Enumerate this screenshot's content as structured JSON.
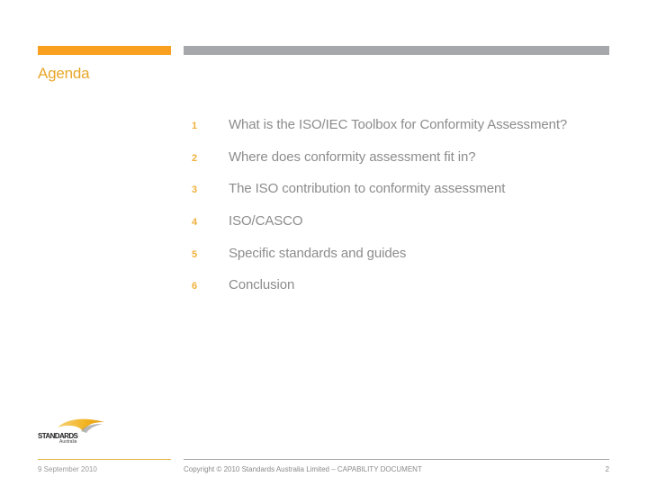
{
  "header": {
    "title": "Agenda",
    "accent_color": "#f9a020",
    "bar_color": "#a6a7ab"
  },
  "agenda": {
    "items": [
      {
        "number": "1",
        "label": "What is the ISO/IEC Toolbox for Conformity Assessment?"
      },
      {
        "number": "2",
        "label": "Where does conformity assessment fit in?"
      },
      {
        "number": "3",
        "label": "The ISO contribution to conformity assessment"
      },
      {
        "number": "4",
        "label": "ISO/CASCO"
      },
      {
        "number": "5",
        "label": "Specific standards and guides"
      },
      {
        "number": "6",
        "label": "Conclusion"
      }
    ]
  },
  "logo": {
    "icon": "standards-australia-logo-icon",
    "wordmark": "STANDARDS",
    "subtext": "Australia"
  },
  "footer": {
    "date": "9 September 2010",
    "copyright": "Copyright © 2010 Standards Australia Limited  –  CAPABILITY DOCUMENT",
    "page_number": "2"
  }
}
